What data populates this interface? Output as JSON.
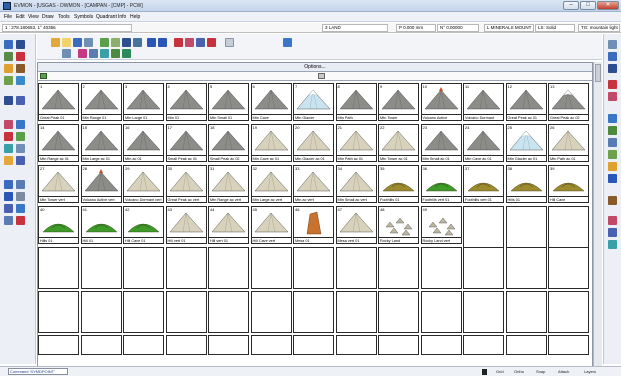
{
  "window": {
    "title": "EVMON - [USGAS - DWMON - [CAMPAN - [CMP] - PCW]",
    "minimize": "–",
    "maximize": "□",
    "close": "✕"
  },
  "menu": {
    "items": [
      "File",
      "Edit",
      "View",
      "Draw",
      "Tools",
      "Symbols",
      "Quadrant",
      "Info",
      "Help"
    ]
  },
  "statusrow": {
    "coords": "1 : 278.180653, 1° 40356",
    "layer": "3 LAND",
    "pos": "P 0.000 mm",
    "scale": "N° 0.00000",
    "symbol": "L MINERALS MOUNT",
    "fill": "LS: Solid",
    "hint": "TG: mountain light 3 x"
  },
  "palette": {
    "header": "Options...",
    "tiles": [
      {
        "num": "1",
        "caption": "Great Peak 01",
        "kind": "rock"
      },
      {
        "num": "2",
        "caption": "Mtn Range 01",
        "kind": "rock"
      },
      {
        "num": "3",
        "caption": "Mtn Large 01",
        "kind": "rock"
      },
      {
        "num": "4",
        "caption": "Mtn 01",
        "kind": "rock"
      },
      {
        "num": "5",
        "caption": "Mtn Small 01",
        "kind": "rock"
      },
      {
        "num": "6",
        "caption": "Mtn Cave",
        "kind": "rock"
      },
      {
        "num": "7",
        "caption": "Mtn Glacier",
        "kind": "glacier"
      },
      {
        "num": "8",
        "caption": "Mtn Path",
        "kind": "rock"
      },
      {
        "num": "9",
        "caption": "Mtn Tower",
        "kind": "rock"
      },
      {
        "num": "10",
        "caption": "Volcano Active",
        "kind": "volcano"
      },
      {
        "num": "11",
        "caption": "Volcano Dormant",
        "kind": "rock"
      },
      {
        "num": "12",
        "caption": "Great Peak ac 01",
        "kind": "rock"
      },
      {
        "num": "13",
        "caption": "Great Peak ac 02",
        "kind": "snow"
      },
      {
        "num": "14",
        "caption": "Mtn Range ac 01",
        "kind": "rock"
      },
      {
        "num": "15",
        "caption": "Mtn Large ac 01",
        "kind": "rock"
      },
      {
        "num": "16",
        "caption": "Mtn ac 01",
        "kind": "rock"
      },
      {
        "num": "17",
        "caption": "Small Peak ac 01",
        "kind": "rock"
      },
      {
        "num": "18",
        "caption": "Small Peak ac 02",
        "kind": "rock"
      },
      {
        "num": "19",
        "caption": "Mtn Cave ac 01",
        "kind": "beige"
      },
      {
        "num": "20",
        "caption": "Mtn Glacier ac 01",
        "kind": "beige"
      },
      {
        "num": "21",
        "caption": "Mtn Path ac 01",
        "kind": "beige"
      },
      {
        "num": "22",
        "caption": "Mtn Tower ac 01",
        "kind": "beige"
      },
      {
        "num": "23",
        "caption": "Mtn Small ac 01",
        "kind": "rock"
      },
      {
        "num": "24",
        "caption": "Mtn Cave ac 01",
        "kind": "rock"
      },
      {
        "num": "25",
        "caption": "Mtn Glacier ac 01",
        "kind": "glacier"
      },
      {
        "num": "26",
        "caption": "Mtn Path ac 01",
        "kind": "beige"
      },
      {
        "num": "27",
        "caption": "Mtn Tower vert",
        "kind": "beige"
      },
      {
        "num": "28",
        "caption": "Volcano Active vert",
        "kind": "volcano"
      },
      {
        "num": "29",
        "caption": "Volcano Dormant vert",
        "kind": "beige"
      },
      {
        "num": "30",
        "caption": "Great Peak ac vert",
        "kind": "beige"
      },
      {
        "num": "31",
        "caption": "Mtn Range ac vert",
        "kind": "beige"
      },
      {
        "num": "32",
        "caption": "Mtn Large ac vert",
        "kind": "beige"
      },
      {
        "num": "33",
        "caption": "Mtn ac vert",
        "kind": "beige"
      },
      {
        "num": "34",
        "caption": "Mtn Small ac vert",
        "kind": "beige"
      },
      {
        "num": "35",
        "caption": "Foothills 01",
        "kind": "olive"
      },
      {
        "num": "36",
        "caption": "Foothills vert 01",
        "kind": "green"
      },
      {
        "num": "37",
        "caption": "Foothills vert 01",
        "kind": "olive"
      },
      {
        "num": "38",
        "caption": "Hills 01",
        "kind": "olive"
      },
      {
        "num": "39",
        "caption": "Hill Cave",
        "kind": "olive"
      },
      {
        "num": "40",
        "caption": "Hills 01",
        "kind": "green"
      },
      {
        "num": "41",
        "caption": "Hill 01",
        "kind": "green"
      },
      {
        "num": "42",
        "caption": "Hill Cave 01",
        "kind": "green"
      },
      {
        "num": "43",
        "caption": "Hill vert 01",
        "kind": "beige"
      },
      {
        "num": "44",
        "caption": "Hill vert 01",
        "kind": "beige"
      },
      {
        "num": "45",
        "caption": "Hill Cave vert",
        "kind": "beige"
      },
      {
        "num": "46",
        "caption": "Mesa 01",
        "kind": "mesa"
      },
      {
        "num": "47",
        "caption": "Mesa vert 01",
        "kind": "beige"
      },
      {
        "num": "48",
        "caption": "Rocky Land",
        "kind": "rocks"
      },
      {
        "num": "49",
        "caption": "Rocky Land vert",
        "kind": "rocks"
      }
    ]
  },
  "statusbar": {
    "message": "Command 'SYMDPOINT'",
    "buttons": [
      "Grid",
      "Ortho",
      "Snap",
      "Attach",
      "Layers"
    ]
  },
  "colors": {
    "rock": "#8c8c88",
    "snow": "#f2f2f2",
    "beige": "#d8d2bc",
    "olive": "#9c8a2e",
    "green": "#3f9a2a",
    "glacier": "#c9e4f0",
    "lava": "#d24a1c",
    "mesa": "#c8722e"
  }
}
